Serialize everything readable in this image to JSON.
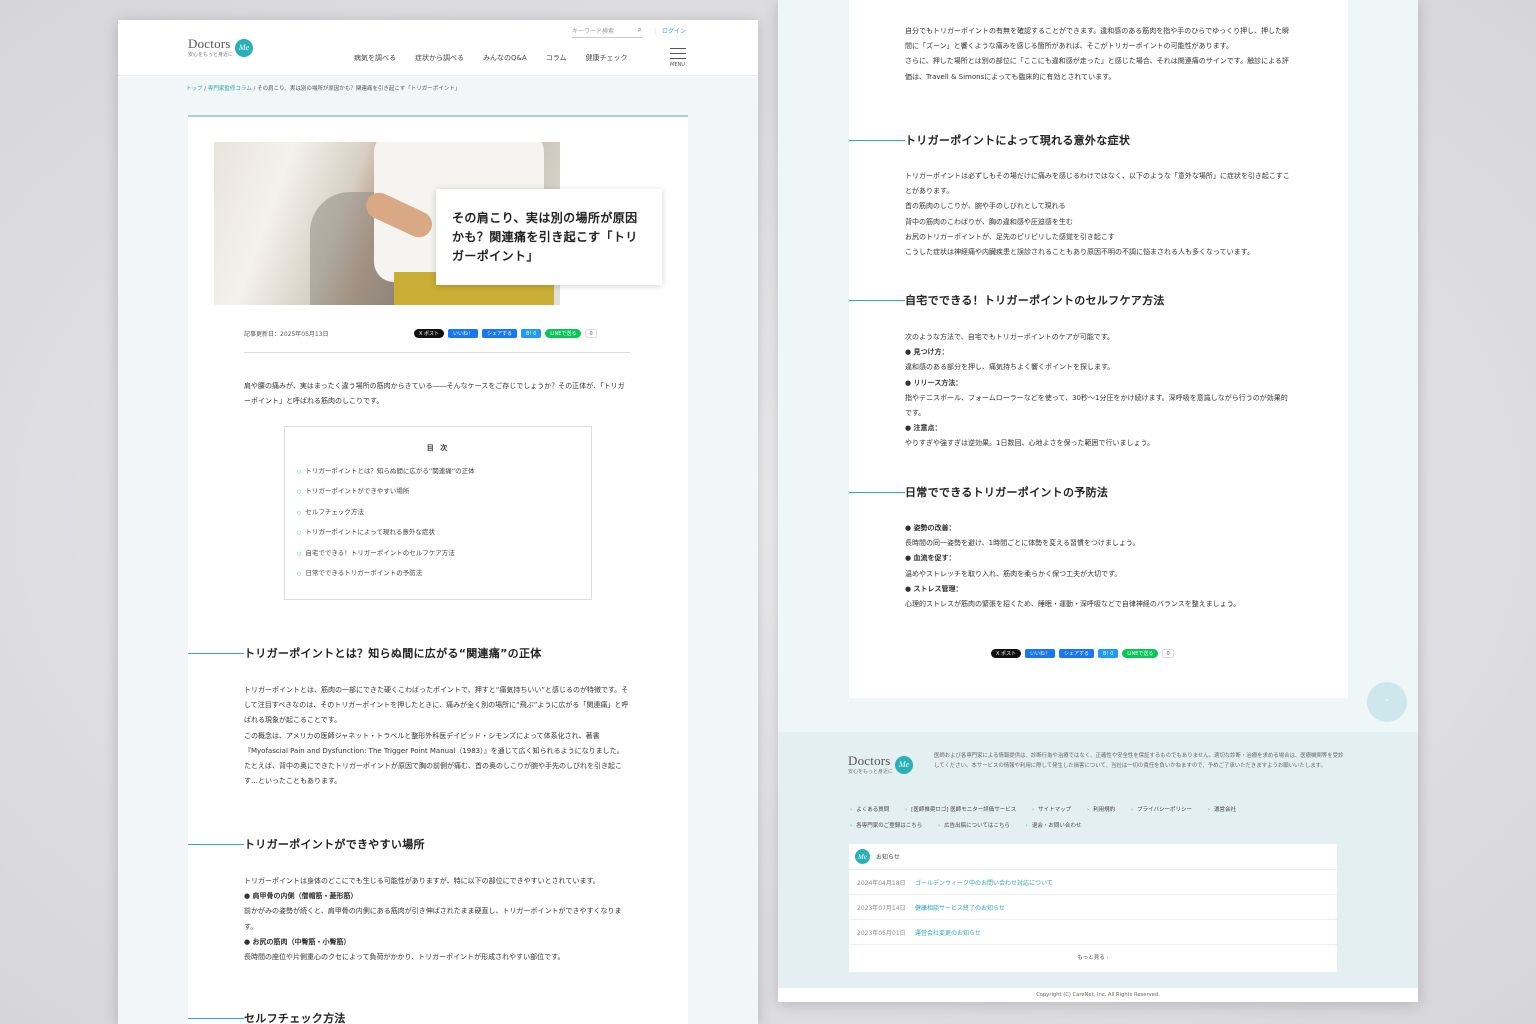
{
  "header": {
    "logo": "Doctors",
    "logo_badge": "Me",
    "logo_tagline": "安心をもっと身近に",
    "search_placeholder": "キーワード検索",
    "login": "ログイン",
    "nav": [
      "病気を調べる",
      "症状から調べる",
      "みんなのQ&A",
      "コラム",
      "健康チェック"
    ],
    "menu_label": "MENU"
  },
  "breadcrumb": {
    "home": "トップ",
    "sep": " / ",
    "category": "専門家監修コラム",
    "current": "その肩こり、実は別の場所が原因かも？関連痛を引き起こす「トリガーポイント」"
  },
  "article": {
    "title": "その肩こり、実は別の場所が原因かも？関連痛を引き起こす「トリガーポイント」",
    "updated": "記事更新日：2025年05月13日",
    "intro": "肩や腰の痛みが、実はまったく違う場所の筋肉からきている――そんなケースをご存じでしょうか？その正体が、「トリガーポイント」と呼ばれる筋肉のしこりです。",
    "toc_title": "目 次",
    "toc": [
      "トリガーポイントとは？知らぬ間に広がる“関連痛”の正体",
      "トリガーポイントができやすい場所",
      "セルフチェック方法",
      "トリガーポイントによって現れる意外な症状",
      "自宅でできる！トリガーポイントのセルフケア方法",
      "日常でできるトリガーポイントの予防法"
    ],
    "sec1": {
      "heading": "トリガーポイントとは？知らぬ間に広がる“関連痛”の正体",
      "p1": "トリガーポイントとは、筋肉の一部にできた硬くこわばったポイントで、押すと“痛気持ちいい”と感じるのが特徴です。そして注目すべきなのは、そのトリガーポイントを押したときに、痛みが全く別の場所に“飛ぶ”ように広がる「関連痛」と呼ばれる現象が起こることです。",
      "p2": "この概念は、アメリカの医師ジャネット・トラベルと整形外科医デイビッド・シモンズによって体系化され、著書『Myofascial Pain and Dysfunction: The Trigger Point Manual（1983）』を通じて広く知られるようになりました。",
      "p3": "たとえば、背中の奥にできたトリガーポイントが原因で胸の前側が痛む、首の奥のしこりが腕や手先のしびれを引き起こす…といったこともあります。"
    },
    "sec2": {
      "heading": "トリガーポイントができやすい場所",
      "p1": "トリガーポイントは身体のどこにでも生じる可能性がありますが、特に以下の部位にできやすいとされています。",
      "b1": "● 肩甲骨の内側（僧帽筋・菱形筋）",
      "t1": "前かがみの姿勢が続くと、肩甲骨の内側にある筋肉が引き伸ばされたまま硬直し、トリガーポイントができやすくなります。",
      "b2": "● お尻の筋肉（中臀筋・小臀筋）",
      "t2": "長時間の座位や片側重心のクセによって負荷がかかり、トリガーポイントが形成されやすい部位です。"
    },
    "sec3": {
      "heading": "セルフチェック方法",
      "p1": "自分でもトリガーポイントの有無を確認することができます。違和感のある筋肉を指や手のひらでゆっくり押し、押した瞬間に「ズーン」と響くような痛みを感じる箇所があれば、そこがトリガーポイントの可能性があります。",
      "p2": "さらに、押した場所とは別の部位に「ここにも違和感が走った」と感じた場合、それは関連痛のサインです。触診による評価は、Travell & Simonsによっても臨床的に有効とされています。"
    },
    "sec4": {
      "heading": "トリガーポイントによって現れる意外な症状",
      "p1": "トリガーポイントは必ずしもその場だけに痛みを感じるわけではなく、以下のような「意外な場所」に症状を引き起こすことがあります。",
      "l1": "首の筋肉のしこりが、腕や手のしびれとして現れる",
      "l2": "背中の筋肉のこわばりが、胸の違和感や圧迫感を生む",
      "l3": "お尻のトリガーポイントが、足先のピリピリした感覚を引き起こす",
      "l4": "こうした症状は神経痛や内臓疾患と誤診されることもあり原因不明の不調に悩まされる人も多くなっています。"
    },
    "sec5": {
      "heading": "自宅でできる！トリガーポイントのセルフケア方法",
      "p1": "次のような方法で、自宅でもトリガーポイントのケアが可能です。",
      "b1": "● 見つけ方：",
      "t1": "違和感のある部分を押し、痛気持ちよく響くポイントを探します。",
      "b2": "● リリース方法：",
      "t2": "指やテニスボール、フォームローラーなどを使って、30秒〜1分圧をかけ続けます。深呼吸を意識しながら行うのが効果的です。",
      "b3": "● 注意点：",
      "t3": "やりすぎや強すぎは逆効果。1日数回、心地よさを保った範囲で行いましょう。"
    },
    "sec6": {
      "heading": "日常でできるトリガーポイントの予防法",
      "b1": "● 姿勢の改善：",
      "t1": "長時間の同一姿勢を避け、1時間ごとに体勢を変える習慣をつけましょう。",
      "b2": "● 血流を促す：",
      "t2": "温めやストレッチを取り入れ、筋肉を柔らかく保つ工夫が大切です。",
      "b3": "● ストレス管理：",
      "t3": "心理的ストレスが筋肉の緊張を招くため、睡眠・運動・深呼吸などで自律神経のバランスを整えましょう。"
    }
  },
  "share": {
    "x": "X ポスト",
    "fb": "いいね！",
    "fb_share": "シェアする",
    "hatena": "B! 0",
    "line": "LINEで送る",
    "count": "0"
  },
  "footer": {
    "disclaimer": "医師および各専門家による情報提供は、診断行為や治療ではなく、正確性や安全性を保証するものでもありません。適切な診断・治療を求める場合は、医療機関等を受診してください。本サービスの情報や利用に際して発生した損害について、当社は一切の責任を負いかねますので、予めご了承いただきますようお願いいたします。",
    "links": [
      "よくある質問",
      "[医師推奨ロゴ] 医師モニター評価サービス",
      "サイトマップ",
      "利用規約",
      "プライバシーポリシー",
      "運営会社",
      "各専門家のご登録はこちら",
      "広告出稿についてはこちら",
      "退会・お問い合わせ"
    ],
    "news_title": "お知らせ",
    "news": [
      {
        "date": "2024年04月18日",
        "title": "ゴールデンウィーク中のお問い合わせ対応について"
      },
      {
        "date": "2023年07月14日",
        "title": "健康相談サービス終了のお知らせ"
      },
      {
        "date": "2023年05月01日",
        "title": "運営会社変更のお知らせ"
      }
    ],
    "more": "もっと見る",
    "copyright": "Copyright (C) CareNet, Inc. All Rights Reserved."
  }
}
